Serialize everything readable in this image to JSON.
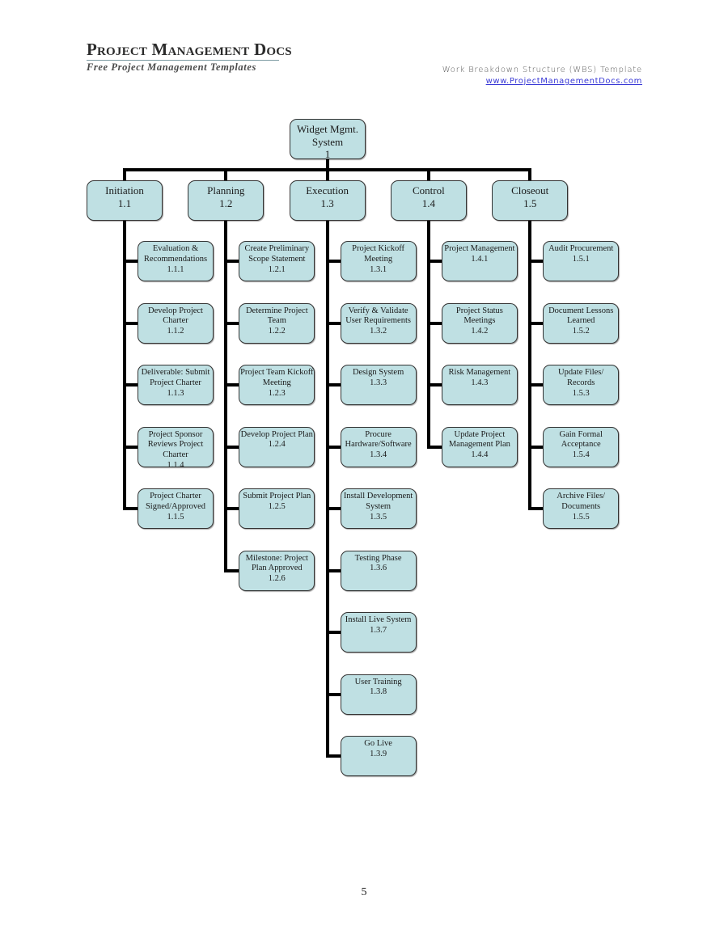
{
  "header": {
    "logo_title": "Project Management Docs",
    "logo_subtitle": "Free Project Management Templates",
    "doc_title": "Work Breakdown Structure (WBS) Template",
    "doc_link": "www.ProjectManagementDocs.com"
  },
  "wbs": {
    "root": {
      "label": "Widget Mgmt. System",
      "code": "1"
    },
    "phases": [
      {
        "label": "Initiation",
        "code": "1.1",
        "tasks": [
          {
            "label": "Evaluation & Recommendations",
            "code": "1.1.1"
          },
          {
            "label": "Develop Project Charter",
            "code": "1.1.2"
          },
          {
            "label": "Deliverable: Submit Project Charter",
            "code": "1.1.3"
          },
          {
            "label": "Project Sponsor Reviews Project Charter",
            "code": "1.1.4"
          },
          {
            "label": "Project Charter Signed/Approved",
            "code": "1.1.5"
          }
        ]
      },
      {
        "label": "Planning",
        "code": "1.2",
        "tasks": [
          {
            "label": "Create Preliminary Scope Statement",
            "code": "1.2.1"
          },
          {
            "label": "Determine Project Team",
            "code": "1.2.2"
          },
          {
            "label": "Project Team Kickoff Meeting",
            "code": "1.2.3"
          },
          {
            "label": "Develop Project Plan",
            "code": "1.2.4"
          },
          {
            "label": "Submit Project Plan",
            "code": "1.2.5"
          },
          {
            "label": "Milestone: Project Plan Approved",
            "code": "1.2.6"
          }
        ]
      },
      {
        "label": "Execution",
        "code": "1.3",
        "tasks": [
          {
            "label": "Project Kickoff Meeting",
            "code": "1.3.1"
          },
          {
            "label": "Verify & Validate User Requirements",
            "code": "1.3.2"
          },
          {
            "label": "Design System",
            "code": "1.3.3"
          },
          {
            "label": "Procure Hardware/Software",
            "code": "1.3.4"
          },
          {
            "label": "Install Development System",
            "code": "1.3.5"
          },
          {
            "label": "Testing Phase",
            "code": "1.3.6"
          },
          {
            "label": "Install Live System",
            "code": "1.3.7"
          },
          {
            "label": "User Training",
            "code": "1.3.8"
          },
          {
            "label": "Go Live",
            "code": "1.3.9"
          }
        ]
      },
      {
        "label": "Control",
        "code": "1.4",
        "tasks": [
          {
            "label": "Project Management",
            "code": "1.4.1"
          },
          {
            "label": "Project Status Meetings",
            "code": "1.4.2"
          },
          {
            "label": "Risk Management",
            "code": "1.4.3"
          },
          {
            "label": "Update Project Management Plan",
            "code": "1.4.4"
          }
        ]
      },
      {
        "label": "Closeout",
        "code": "1.5",
        "tasks": [
          {
            "label": "Audit Procurement",
            "code": "1.5.1"
          },
          {
            "label": "Document Lessons Learned",
            "code": "1.5.2"
          },
          {
            "label": "Update Files/ Records",
            "code": "1.5.3"
          },
          {
            "label": "Gain Formal Acceptance",
            "code": "1.5.4"
          },
          {
            "label": "Archive Files/ Documents",
            "code": "1.5.5"
          }
        ]
      }
    ]
  },
  "colors": {
    "node_fill": "#bfe0e3",
    "node_border": "#333333",
    "connector": "#000000",
    "link": "#3a3ad6"
  },
  "footer": {
    "page_number": "5"
  }
}
